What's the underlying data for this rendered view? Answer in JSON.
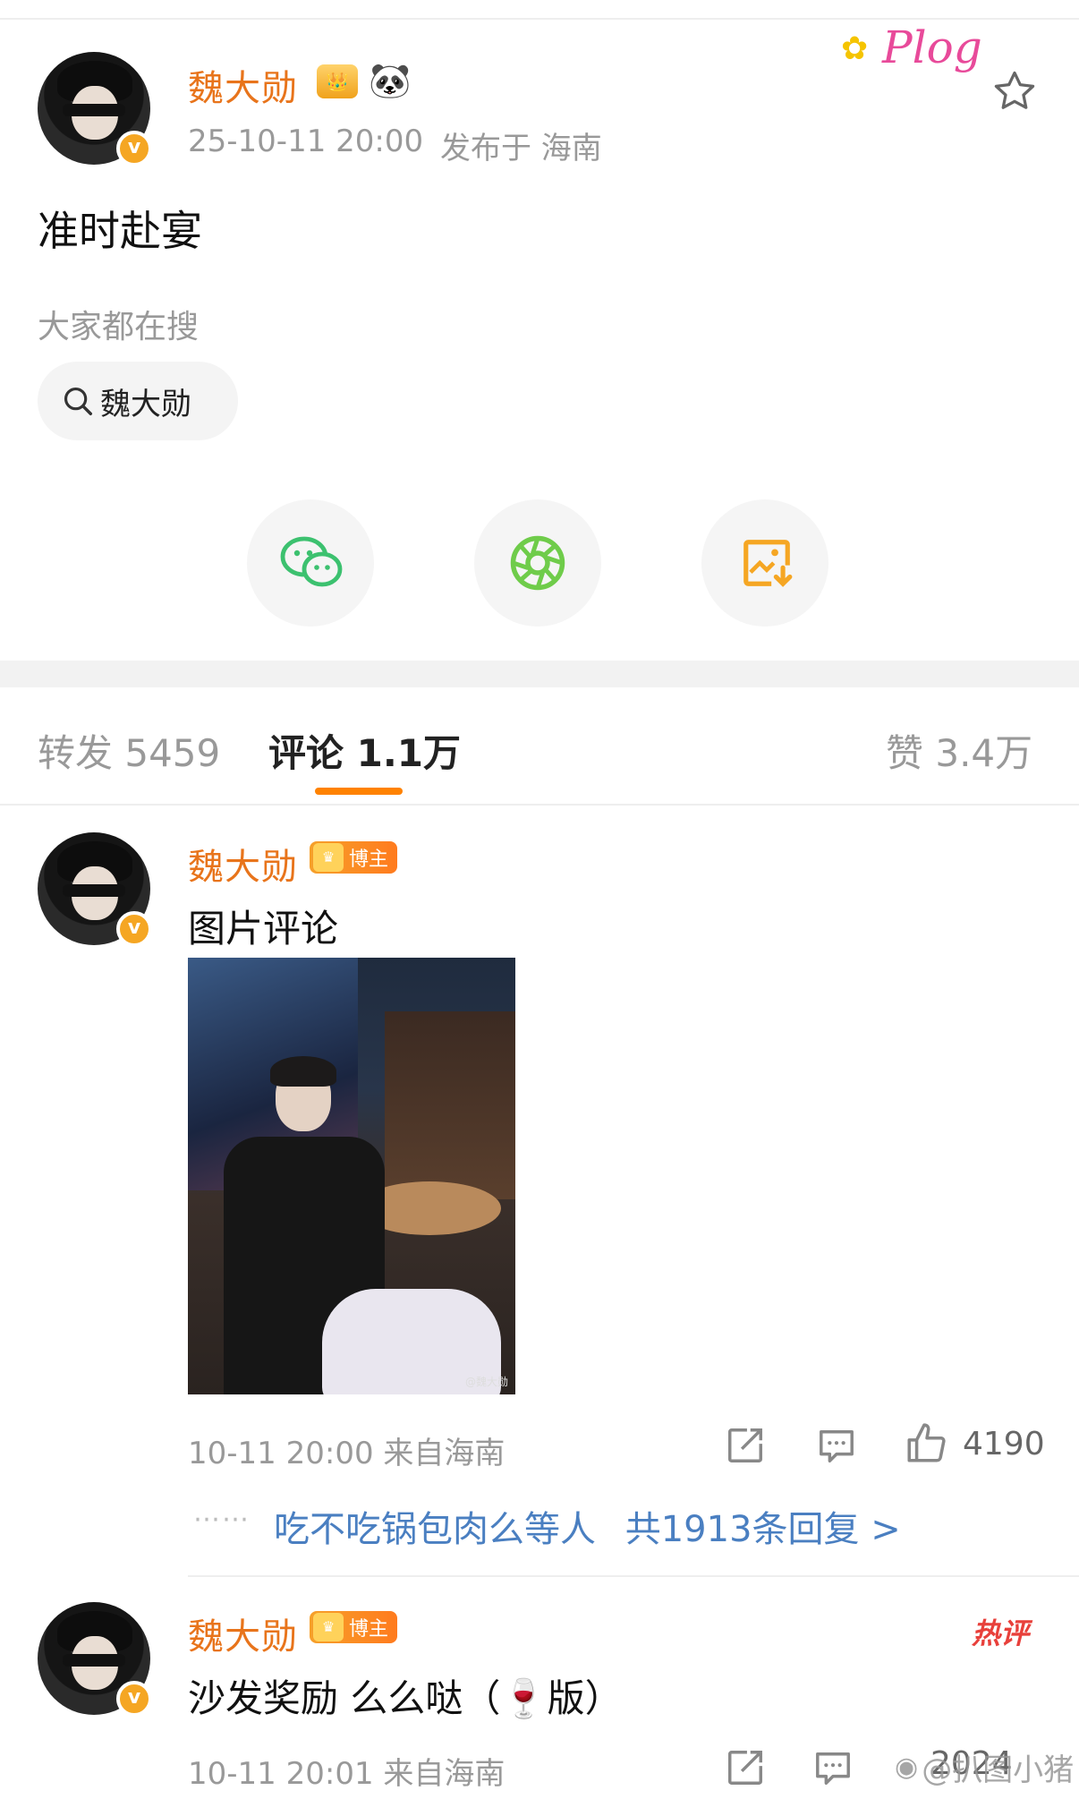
{
  "post": {
    "author": "魏大勋",
    "timestamp": "25-10-11 20:00",
    "location": "发布于 海南",
    "content": "准时赴宴",
    "plog_label": "Plog"
  },
  "search": {
    "heading": "大家都在搜",
    "chip": "魏大勋"
  },
  "share": {
    "icons": [
      "wechat-icon",
      "moments-icon",
      "save-image-icon"
    ]
  },
  "tabs": {
    "repost": "转发 5459",
    "comment": "评论 1.1万",
    "like": "赞 3.4万"
  },
  "comments": [
    {
      "author": "魏大勋",
      "badge": "博主",
      "text": "图片评论",
      "meta": "10-11 20:00 来自海南",
      "likes": "4190",
      "reply_user": "吃不吃锅包肉么等人",
      "reply_count": "共1913条回复 >",
      "photo_watermark": "@魏大勋"
    },
    {
      "author": "魏大勋",
      "badge": "博主",
      "text": "沙发奖励 么么哒（🍷版）",
      "meta": "10-11 20:01 来自海南",
      "hot_label": "热评",
      "likes": "2024"
    }
  ],
  "watermark": "@扒图小猪",
  "colors": {
    "accent": "#e8741b",
    "tab_underline": "#ff8200",
    "link_blue": "#4a7fc1",
    "wechat_green": "#3cc16f",
    "save_orange": "#f5a623",
    "hot_red": "#e8403b"
  }
}
